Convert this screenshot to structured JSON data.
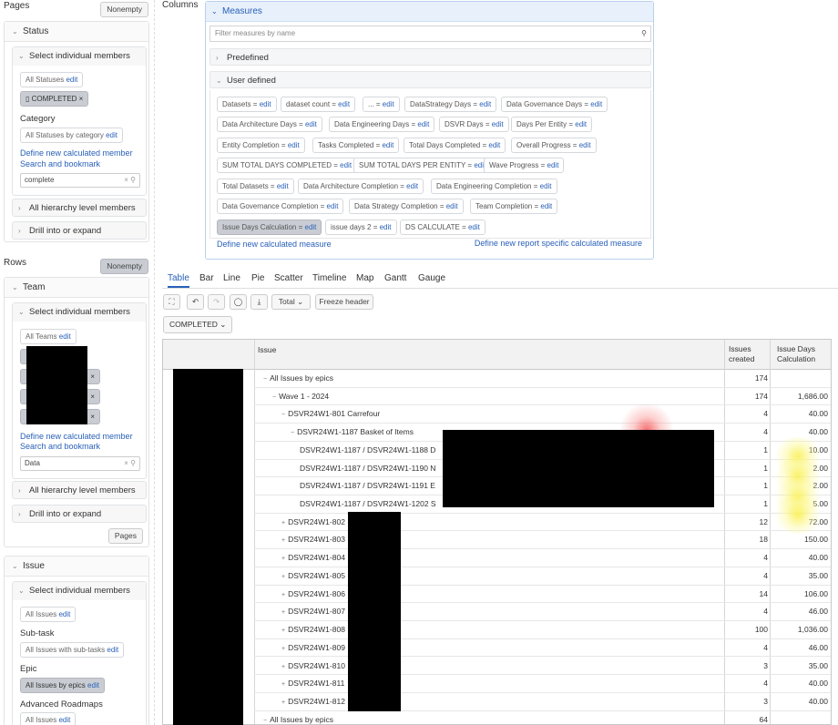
{
  "pages": {
    "label": "Pages",
    "nonempty_button": "Nonempty",
    "status_section": "Status",
    "select_members": "Select individual members",
    "all_statuses_chip": "All Statuses",
    "edit": "edit",
    "completed_chip": "COMPLETED",
    "category_label": "Category",
    "all_statuses_by_category_chip": "All Statuses by category",
    "define_calc_member": "Define new calculated member",
    "search_bookmark": "Search and bookmark",
    "search_value": "complete",
    "all_hierarchy": "All hierarchy level members",
    "drill": "Drill into or expand"
  },
  "rows_panel": {
    "label": "Rows",
    "nonempty_button": "Nonempty",
    "team_section": "Team",
    "select_members": "Select individual members",
    "all_teams_chip": "All Teams",
    "define_calc_member": "Define new calculated member",
    "search_bookmark": "Search and bookmark",
    "search_value": "Data",
    "all_hierarchy": "All hierarchy level members",
    "drill": "Drill into or expand",
    "pages_button": "Pages",
    "issue_section": "Issue",
    "issue_select_members": "Select individual members",
    "all_issues_chip": "All Issues",
    "subtask_label": "Sub-task",
    "all_issues_subtasks_chip": "All Issues with sub-tasks",
    "epic_label": "Epic",
    "all_issues_epics_chip": "All Issues by epics",
    "adv_roadmaps_label": "Advanced Roadmaps",
    "all_issues_chip2": "All Issues"
  },
  "columns": {
    "label": "Columns",
    "measures_title": "Measures",
    "filter_placeholder": "Filter measures by name",
    "predefined": "Predefined",
    "user_defined": "User defined",
    "chips": [
      "Datasets = ",
      "dataset count = ",
      "... = ",
      "DataStrategy Days = ",
      "Data Governance Days = ",
      "Data Architecture Days = ",
      "Data Engineering Days = ",
      "DSVR Days = ",
      "Days Per Entity = ",
      "Entity Completion = ",
      "Tasks Completed = ",
      "Total Days Completed = ",
      "Overall Progress = ",
      "SUM TOTAL DAYS COMPLETED = ",
      "SUM TOTAL DAYS PER ENTITY = ",
      "Wave Progress = ",
      "Total Datasets = ",
      "Data Architecture Completion = ",
      "Data Engineering Completion = ",
      "Data Governance Completion = ",
      "Data Strategy Completion = ",
      "Team Completion = ",
      "Issue Days Calculation = ",
      "issue days 2 = ",
      "DS CALCULATE = "
    ],
    "define_measure": "Define new calculated measure",
    "define_report_measure": "Define new report specific calculated measure"
  },
  "tabs": [
    "Table",
    "Bar",
    "Line",
    "Pie",
    "Scatter",
    "Timeline",
    "Map",
    "Gantt",
    "Gauge"
  ],
  "toolbar": {
    "total": "Total",
    "freeze_header": "Freeze header",
    "page_filter": "COMPLETED"
  },
  "table": {
    "col_issue": "Issue",
    "col_created": "Issues created",
    "col_days": "Issue Days Calculation",
    "rows": [
      {
        "name": "All Issues by epics",
        "created": "174",
        "days": ""
      },
      {
        "name": "Wave 1 - 2024",
        "created": "174",
        "days": "1,686.00"
      },
      {
        "name": "DSVR24W1-801 Carrefour",
        "created": "4",
        "days": "40.00"
      },
      {
        "name": "DSVR24W1-1187 Basket of Items",
        "created": "4",
        "days": "40.00"
      },
      {
        "name": "DSVR24W1-1187 / DSVR24W1-1188 D",
        "created": "1",
        "days": "10.00"
      },
      {
        "name": "DSVR24W1-1187 / DSVR24W1-1190 N",
        "created": "1",
        "days": "2.00"
      },
      {
        "name": "DSVR24W1-1187 / DSVR24W1-1191 E",
        "created": "1",
        "days": "2.00"
      },
      {
        "name": "DSVR24W1-1187 / DSVR24W1-1202 S",
        "created": "1",
        "days": "5.00"
      },
      {
        "name": "DSVR24W1-802",
        "created": "12",
        "days": "72.00"
      },
      {
        "name": "DSVR24W1-803",
        "created": "18",
        "days": "150.00"
      },
      {
        "name": "DSVR24W1-804",
        "created": "4",
        "days": "40.00"
      },
      {
        "name": "DSVR24W1-805",
        "created": "4",
        "days": "35.00"
      },
      {
        "name": "DSVR24W1-806",
        "created": "14",
        "days": "106.00"
      },
      {
        "name": "DSVR24W1-807",
        "created": "4",
        "days": "46.00"
      },
      {
        "name": "DSVR24W1-808",
        "created": "100",
        "days": "1,036.00"
      },
      {
        "name": "DSVR24W1-809",
        "created": "4",
        "days": "46.00"
      },
      {
        "name": "DSVR24W1-810",
        "created": "3",
        "days": "35.00"
      },
      {
        "name": "DSVR24W1-811",
        "created": "4",
        "days": "40.00"
      },
      {
        "name": "DSVR24W1-812",
        "created": "3",
        "days": "40.00"
      },
      {
        "name": "All Issues by epics",
        "created": "64",
        "days": ""
      }
    ]
  }
}
